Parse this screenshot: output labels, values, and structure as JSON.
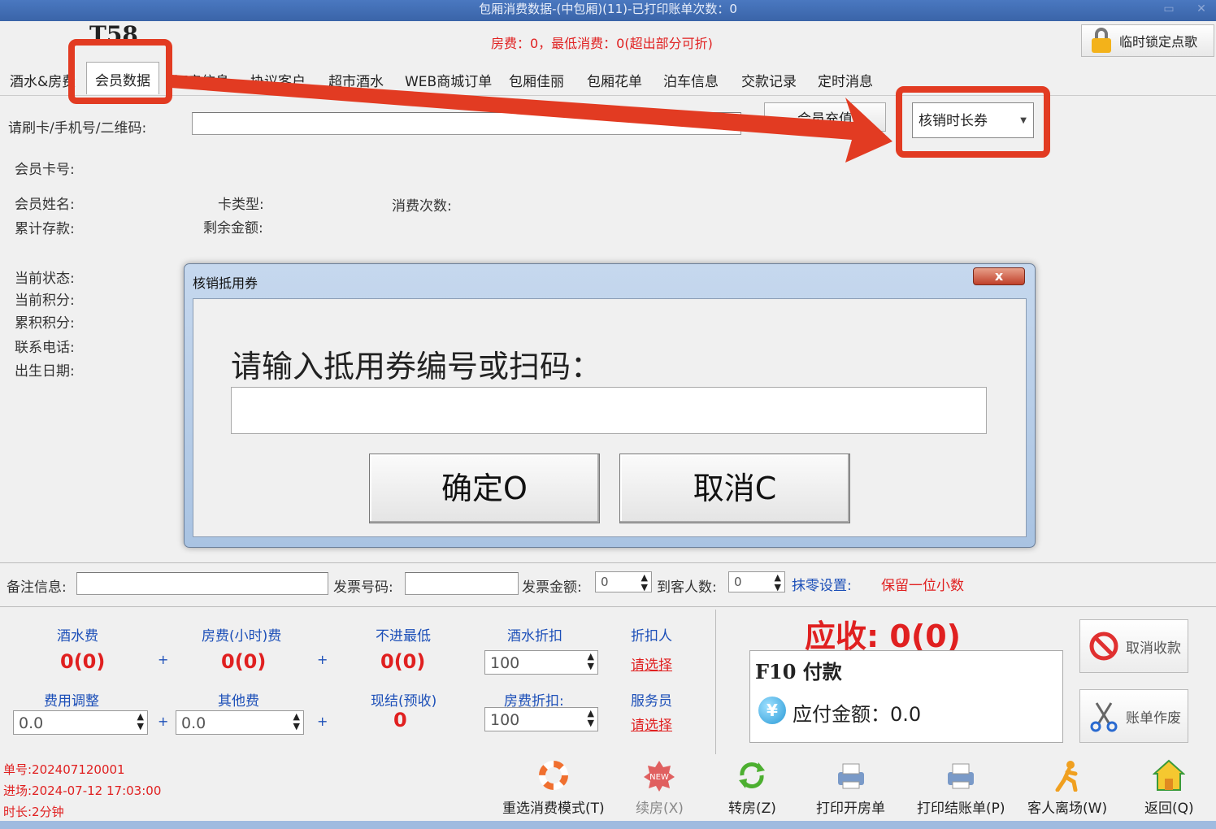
{
  "window": {
    "title": "包厢消费数据-(中包厢)(11)-已打印账单次数：0",
    "room_code": "T58"
  },
  "header": {
    "fee_line": "房费：0，最低消费：0(超出部分可折)",
    "lock_button": "临时锁定点歌"
  },
  "tabs": [
    "酒水&房费",
    "会员数据",
    "订房信息",
    "协议客户",
    "超市酒水",
    "WEB商城订单",
    "包厢佳丽",
    "包厢花单",
    "泊车信息",
    "交款记录",
    "定时消息"
  ],
  "member": {
    "card_label": "请刷卡/手机号/二维码:",
    "recharge_button": "会员充值",
    "verify_select": "核销时长券",
    "card_no": "会员卡号:",
    "name": "会员姓名:",
    "card_type": "卡类型:",
    "consume_count": "消费次数:",
    "total_deposit": "累计存款:",
    "remaining": "剩余金额:",
    "status": "当前状态:",
    "points": "当前积分:",
    "accum_points": "累积积分:",
    "phone": "联系电话:",
    "birthday": "出生日期:"
  },
  "dialog": {
    "title": "核销抵用券",
    "close": "x",
    "prompt": "请输入抵用券编号或扫码：",
    "confirm": "确定O",
    "cancel": "取消C"
  },
  "remarks": {
    "note_label": "备注信息:",
    "invoice_no_label": "发票号码:",
    "invoice_amount_label": "发票金额:",
    "invoice_amount": "0",
    "guests_label": "到客人数:",
    "guests": "0",
    "rounding_label": "抹零设置:",
    "rounding_value": "保留一位小数"
  },
  "fees": {
    "drinks_label": "酒水费",
    "drinks": "0(0)",
    "room_label": "房费(小时)费",
    "room": "0(0)",
    "min_label": "不进最低",
    "min": "0(0)",
    "drink_discount_label": "酒水折扣",
    "drink_discount": "100",
    "discounter_label": "折扣人",
    "discounter": "请选择",
    "adjust_label": "费用调整",
    "adjust": "0.0",
    "other_label": "其他费",
    "other": "0.0",
    "cash_label": "现结(预收)",
    "cash": "0",
    "room_discount_label": "房费折扣:",
    "room_discount": "100",
    "waiter_label": "服务员",
    "waiter": "请选择",
    "plus": "+"
  },
  "payment": {
    "receivable": "应收: 0(0)",
    "f10": "F10 付款",
    "payable": "应付金额：0.0",
    "cancel_collect": "取消收款",
    "void_bill": "账单作废"
  },
  "bill_info": {
    "bill_no": "单号:202407120001",
    "entry": "进场:2024-07-12 17:03:00",
    "duration": "时长:2分钟"
  },
  "toolbar": [
    "重选消费模式(T)",
    "续房(X)",
    "转房(Z)",
    "打印开房单",
    "打印结账单(P)",
    "客人离场(W)",
    "返回(Q)"
  ],
  "colors": {
    "title_bar": "#3a64a8",
    "highlight": "#e23b22",
    "label_blue": "#1c4fb8",
    "red_text": "#e02020"
  },
  "icons": [
    "lock-icon",
    "lifebuoy-icon",
    "new-badge-icon",
    "refresh-icon",
    "printer-icon",
    "printer-icon",
    "person-run-icon",
    "home-icon",
    "prohibit-icon",
    "scissors-icon",
    "yen-icon"
  ]
}
